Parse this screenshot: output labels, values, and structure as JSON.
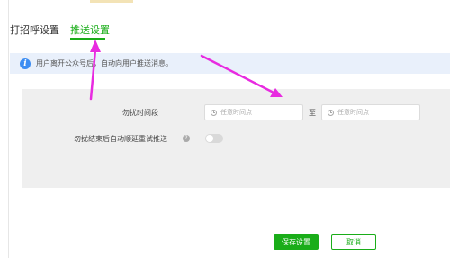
{
  "tabs": [
    {
      "label": "打招呼设置",
      "active": false
    },
    {
      "label": "推送设置",
      "active": true
    }
  ],
  "info": {
    "icon": "info-icon",
    "text": "用户离开公众号后，自动向用户推送消息。"
  },
  "form": {
    "quiet_period_label": "勿扰时间段",
    "start_placeholder": "任意时间点",
    "range_separator": "至",
    "end_placeholder": "任意时间点",
    "resume_label": "勿扰结束后自动顺延重试推送",
    "resume_enabled": false
  },
  "actions": {
    "save_label": "保存设置",
    "cancel_label": "取消"
  },
  "colors": {
    "accent": "#1aad19",
    "info_bg": "#e9f0fb",
    "panel_bg": "#efefef",
    "annotation": "#e82be0"
  }
}
